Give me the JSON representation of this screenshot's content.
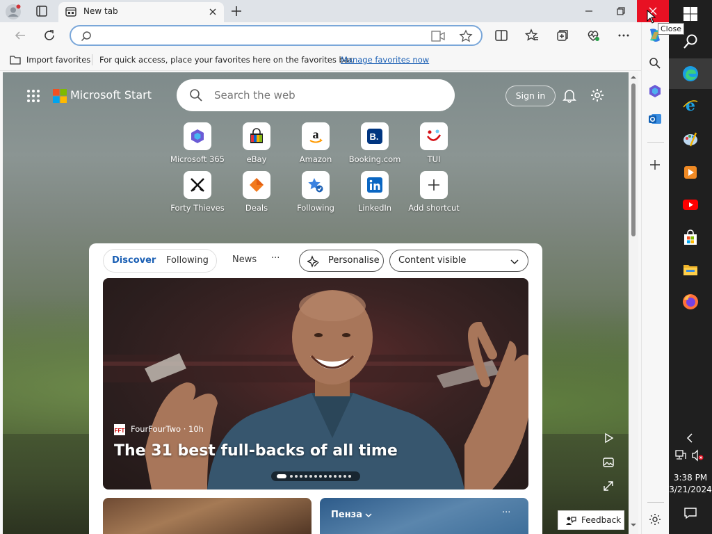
{
  "browser": {
    "tab": {
      "title": "New tab"
    },
    "window_controls": {
      "close_tooltip": "Close"
    },
    "address_bar": {
      "value": "",
      "placeholder": ""
    }
  },
  "favorites_bar": {
    "import_label": "Import favorites",
    "hint": "For quick access, place your favorites here on the favorites bar.",
    "manage_link": "Manage favorites now"
  },
  "start_page": {
    "brand": "Microsoft Start",
    "search_placeholder": "Search the web",
    "sign_in": "Sign in",
    "shortcuts": [
      {
        "label": "Microsoft 365",
        "icon": "microsoft-365-icon"
      },
      {
        "label": "eBay",
        "icon": "ebay-icon"
      },
      {
        "label": "Amazon",
        "icon": "amazon-icon"
      },
      {
        "label": "Booking.com",
        "icon": "booking-icon"
      },
      {
        "label": "TUI",
        "icon": "tui-icon"
      },
      {
        "label": "Forty Thieves",
        "icon": "forty-thieves-icon"
      },
      {
        "label": "Deals",
        "icon": "deals-icon"
      },
      {
        "label": "Following",
        "icon": "following-icon"
      },
      {
        "label": "LinkedIn",
        "icon": "linkedin-icon"
      },
      {
        "label": "Add shortcut",
        "icon": "plus-icon"
      }
    ],
    "feed_tabs": {
      "discover": "Discover",
      "following": "Following",
      "news": "News",
      "more": "···"
    },
    "personalise": "Personalise",
    "content_visibility": "Content visible",
    "hero": {
      "source": "FourFourTwo · 10h",
      "source_logo": "FFT",
      "headline": "The 31 best full-backs of all time"
    },
    "weather_card": {
      "city": "Пенза",
      "more": "···"
    },
    "feedback": "Feedback"
  },
  "taskbar": {
    "time": "3:38 PM",
    "date": "3/21/2024"
  },
  "colors": {
    "close_red": "#e81123",
    "accent_blue": "#1a5fb4",
    "taskbar": "#1f1f1f"
  }
}
